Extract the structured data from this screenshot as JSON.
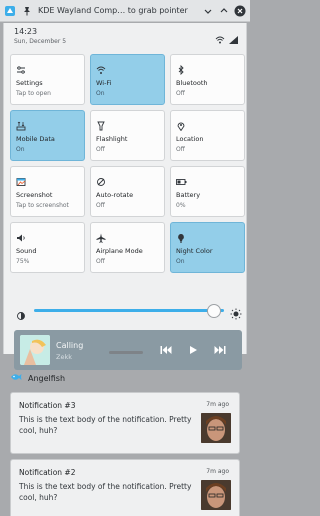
{
  "window": {
    "title": "KDE Wayland Comp… to grab pointer"
  },
  "status": {
    "time": "14:23",
    "date": "Sun, December 5"
  },
  "tiles": [
    {
      "label": "Settings",
      "status": "Tap to open",
      "icon": "settings-icon",
      "active": false
    },
    {
      "label": "Wi-Fi",
      "status": "On",
      "icon": "wifi-icon",
      "active": true
    },
    {
      "label": "Bluetooth",
      "status": "Off",
      "icon": "bluetooth-icon",
      "active": false
    },
    {
      "label": "Mobile Data",
      "status": "On",
      "icon": "mobile-data-icon",
      "active": true
    },
    {
      "label": "Flashlight",
      "status": "Off",
      "icon": "flashlight-icon",
      "active": false
    },
    {
      "label": "Location",
      "status": "Off",
      "icon": "location-icon",
      "active": false
    },
    {
      "label": "Screenshot",
      "status": "Tap to screenshot",
      "icon": "screenshot-icon",
      "active": false
    },
    {
      "label": "Auto-rotate",
      "status": "Off",
      "icon": "auto-rotate-icon",
      "active": false
    },
    {
      "label": "Battery",
      "status": "0%",
      "icon": "battery-icon",
      "active": false
    },
    {
      "label": "Sound",
      "status": "75%",
      "icon": "sound-icon",
      "active": false
    },
    {
      "label": "Airplane Mode",
      "status": "Off",
      "icon": "airplane-icon",
      "active": false
    },
    {
      "label": "Night Color",
      "status": "On",
      "icon": "night-color-icon",
      "active": true
    }
  ],
  "brightness": {
    "level": 0.9
  },
  "media": {
    "title": "Calling",
    "artist": "Zekk"
  },
  "notifications": {
    "app": "Angelfish",
    "items": [
      {
        "title": "Notification #3",
        "time": "7m ago",
        "body": "This is the text body of the notification. Pretty cool, huh?"
      },
      {
        "title": "Notification #2",
        "time": "7m ago",
        "body": "This is the text body of the notification. Pretty cool, huh?"
      }
    ]
  },
  "colors": {
    "accent": "#3daee9",
    "active_tile": "#93cee9"
  }
}
